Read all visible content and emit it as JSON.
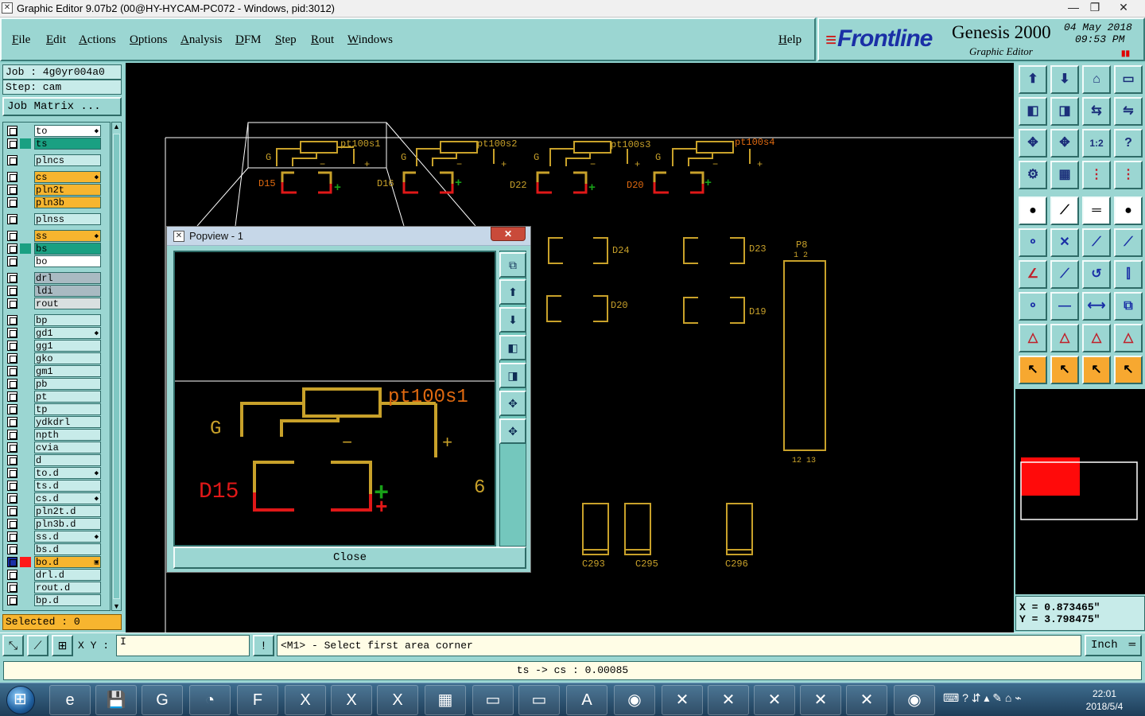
{
  "window": {
    "title": "Graphic Editor 9.07b2 (00@HY-HYCAM-PC072 - Windows, pid:3012)",
    "minimize": "—",
    "maximize": "❐",
    "close": "✕"
  },
  "menu": [
    "File",
    "Edit",
    "Actions",
    "Options",
    "Analysis",
    "DFM",
    "Step",
    "Rout",
    "Windows"
  ],
  "help_label": "Help",
  "brand": {
    "logo": "Frontline",
    "product": "Genesis 2000",
    "subtitle": "Graphic Editor",
    "date": "04 May 2018",
    "time": "09:53 PM"
  },
  "left": {
    "job": "Job : 4g0yr004a0",
    "step": "Step: cam",
    "job_matrix": "Job Matrix ...",
    "selected": "Selected : 0",
    "layers": [
      {
        "name": "to",
        "bg": "#ffffff",
        "mark": "◆"
      },
      {
        "name": "ts",
        "bg": "#1aa082",
        "mark": ""
      },
      {
        "name": "plncs",
        "bg": "#c7ebe9",
        "mark": ""
      },
      {
        "name": "cs",
        "bg": "#f7b52f",
        "mark": "◆"
      },
      {
        "name": "pln2t",
        "bg": "#f7b52f",
        "mark": ""
      },
      {
        "name": "pln3b",
        "bg": "#f7b52f",
        "mark": ""
      },
      {
        "name": "plnss",
        "bg": "#c7ebe9",
        "mark": ""
      },
      {
        "name": "ss",
        "bg": "#f7b52f",
        "mark": "◆"
      },
      {
        "name": "bs",
        "bg": "#1aa082",
        "mark": ""
      },
      {
        "name": "bo",
        "bg": "#ffffff",
        "mark": ""
      },
      {
        "name": "drl",
        "bg": "#a9bac2",
        "mark": ""
      },
      {
        "name": "ldi",
        "bg": "#a9bac2",
        "mark": ""
      },
      {
        "name": "rout",
        "bg": "#d9e0e0",
        "mark": ""
      },
      {
        "name": "bp",
        "bg": "#c7ebe9",
        "mark": ""
      },
      {
        "name": "gd1",
        "bg": "#c7ebe9",
        "mark": "◆"
      },
      {
        "name": "gg1",
        "bg": "#c7ebe9",
        "mark": ""
      },
      {
        "name": "gko",
        "bg": "#c7ebe9",
        "mark": ""
      },
      {
        "name": "gm1",
        "bg": "#c7ebe9",
        "mark": ""
      },
      {
        "name": "pb",
        "bg": "#c7ebe9",
        "mark": ""
      },
      {
        "name": "pt",
        "bg": "#c7ebe9",
        "mark": ""
      },
      {
        "name": "tp",
        "bg": "#c7ebe9",
        "mark": ""
      },
      {
        "name": "ydkdrl",
        "bg": "#c7ebe9",
        "mark": ""
      },
      {
        "name": "npth",
        "bg": "#c7ebe9",
        "mark": ""
      },
      {
        "name": "cvia",
        "bg": "#c7ebe9",
        "mark": ""
      },
      {
        "name": "d",
        "bg": "#c7ebe9",
        "mark": ""
      },
      {
        "name": "to.d",
        "bg": "#c7ebe9",
        "mark": "◆"
      },
      {
        "name": "ts.d",
        "bg": "#c7ebe9",
        "mark": ""
      },
      {
        "name": "cs.d",
        "bg": "#c7ebe9",
        "mark": "◆"
      },
      {
        "name": "pln2t.d",
        "bg": "#c7ebe9",
        "mark": ""
      },
      {
        "name": "pln3b.d",
        "bg": "#c7ebe9",
        "mark": ""
      },
      {
        "name": "ss.d",
        "bg": "#c7ebe9",
        "mark": "◆"
      },
      {
        "name": "bs.d",
        "bg": "#c7ebe9",
        "mark": ""
      },
      {
        "name": "bo.d",
        "bg": "#f7b52f",
        "mark": "▣"
      },
      {
        "name": "drl.d",
        "bg": "#c7ebe9",
        "mark": ""
      },
      {
        "name": "rout.d",
        "bg": "#c7ebe9",
        "mark": ""
      },
      {
        "name": "bp.d",
        "bg": "#c7ebe9",
        "mark": ""
      }
    ]
  },
  "canvas_labels": {
    "d15": "D15",
    "d16": "D16",
    "d22": "D22",
    "d20": "D20",
    "d24": "D24",
    "d23": "D23",
    "d20b": "D20",
    "d19": "D19",
    "p8": "P8",
    "p8_pin": "1  2",
    "p8_bottom": "12 13",
    "c293": "C293",
    "c295": "C295",
    "c296": "C296",
    "pt1": "pt100s1",
    "pt2": "pt100s2",
    "pt3": "pt100s3",
    "pt4": "pt100s4",
    "g": "G",
    "plus": "+",
    "minus": "−"
  },
  "popview": {
    "title": "Popview - 1",
    "close_x": "✕",
    "close_button": "Close",
    "label_pt": "pt100s1",
    "label_d15": "D15",
    "label_g": "G",
    "label_six": "6",
    "label_plus": "+",
    "label_minus": "−"
  },
  "right": {
    "coord_x": "X = 0.873465\"",
    "coord_y": "Y = 3.798475\"",
    "tool_glyphs": [
      "⬆",
      "⬇",
      "⌂",
      "▭",
      "◧",
      "◨",
      "⇆",
      "⇋",
      "✥",
      "✥",
      "1:2",
      "?",
      "⚙",
      "▦",
      "⋮",
      "⋮",
      "●",
      "⟋",
      "═",
      "●",
      "⚬",
      "✕",
      "⟋",
      "⟋",
      "∠",
      "⟋",
      "↺",
      "⫿",
      "⚬",
      "—",
      "⟷",
      "⧉",
      "△",
      "△",
      "△",
      "△",
      "↖",
      "↖",
      "↖",
      "↖"
    ]
  },
  "command": {
    "xy_label": "X Y :",
    "xy_value": "I",
    "prompt": "<M1> - Select first area corner",
    "units": "Inch",
    "status": "ts -> cs : 0.00085"
  },
  "taskbar": {
    "clock_time": "22:01",
    "clock_date": "2018/5/4",
    "tray": "⌨ ? ⇵ ▴ ✎ ⌂ ⌁"
  },
  "colors": {
    "copper": "#c8a12a",
    "red": "#e01818",
    "green": "#18a018",
    "panel": "#9bd6d2",
    "canvas": "#000000"
  }
}
